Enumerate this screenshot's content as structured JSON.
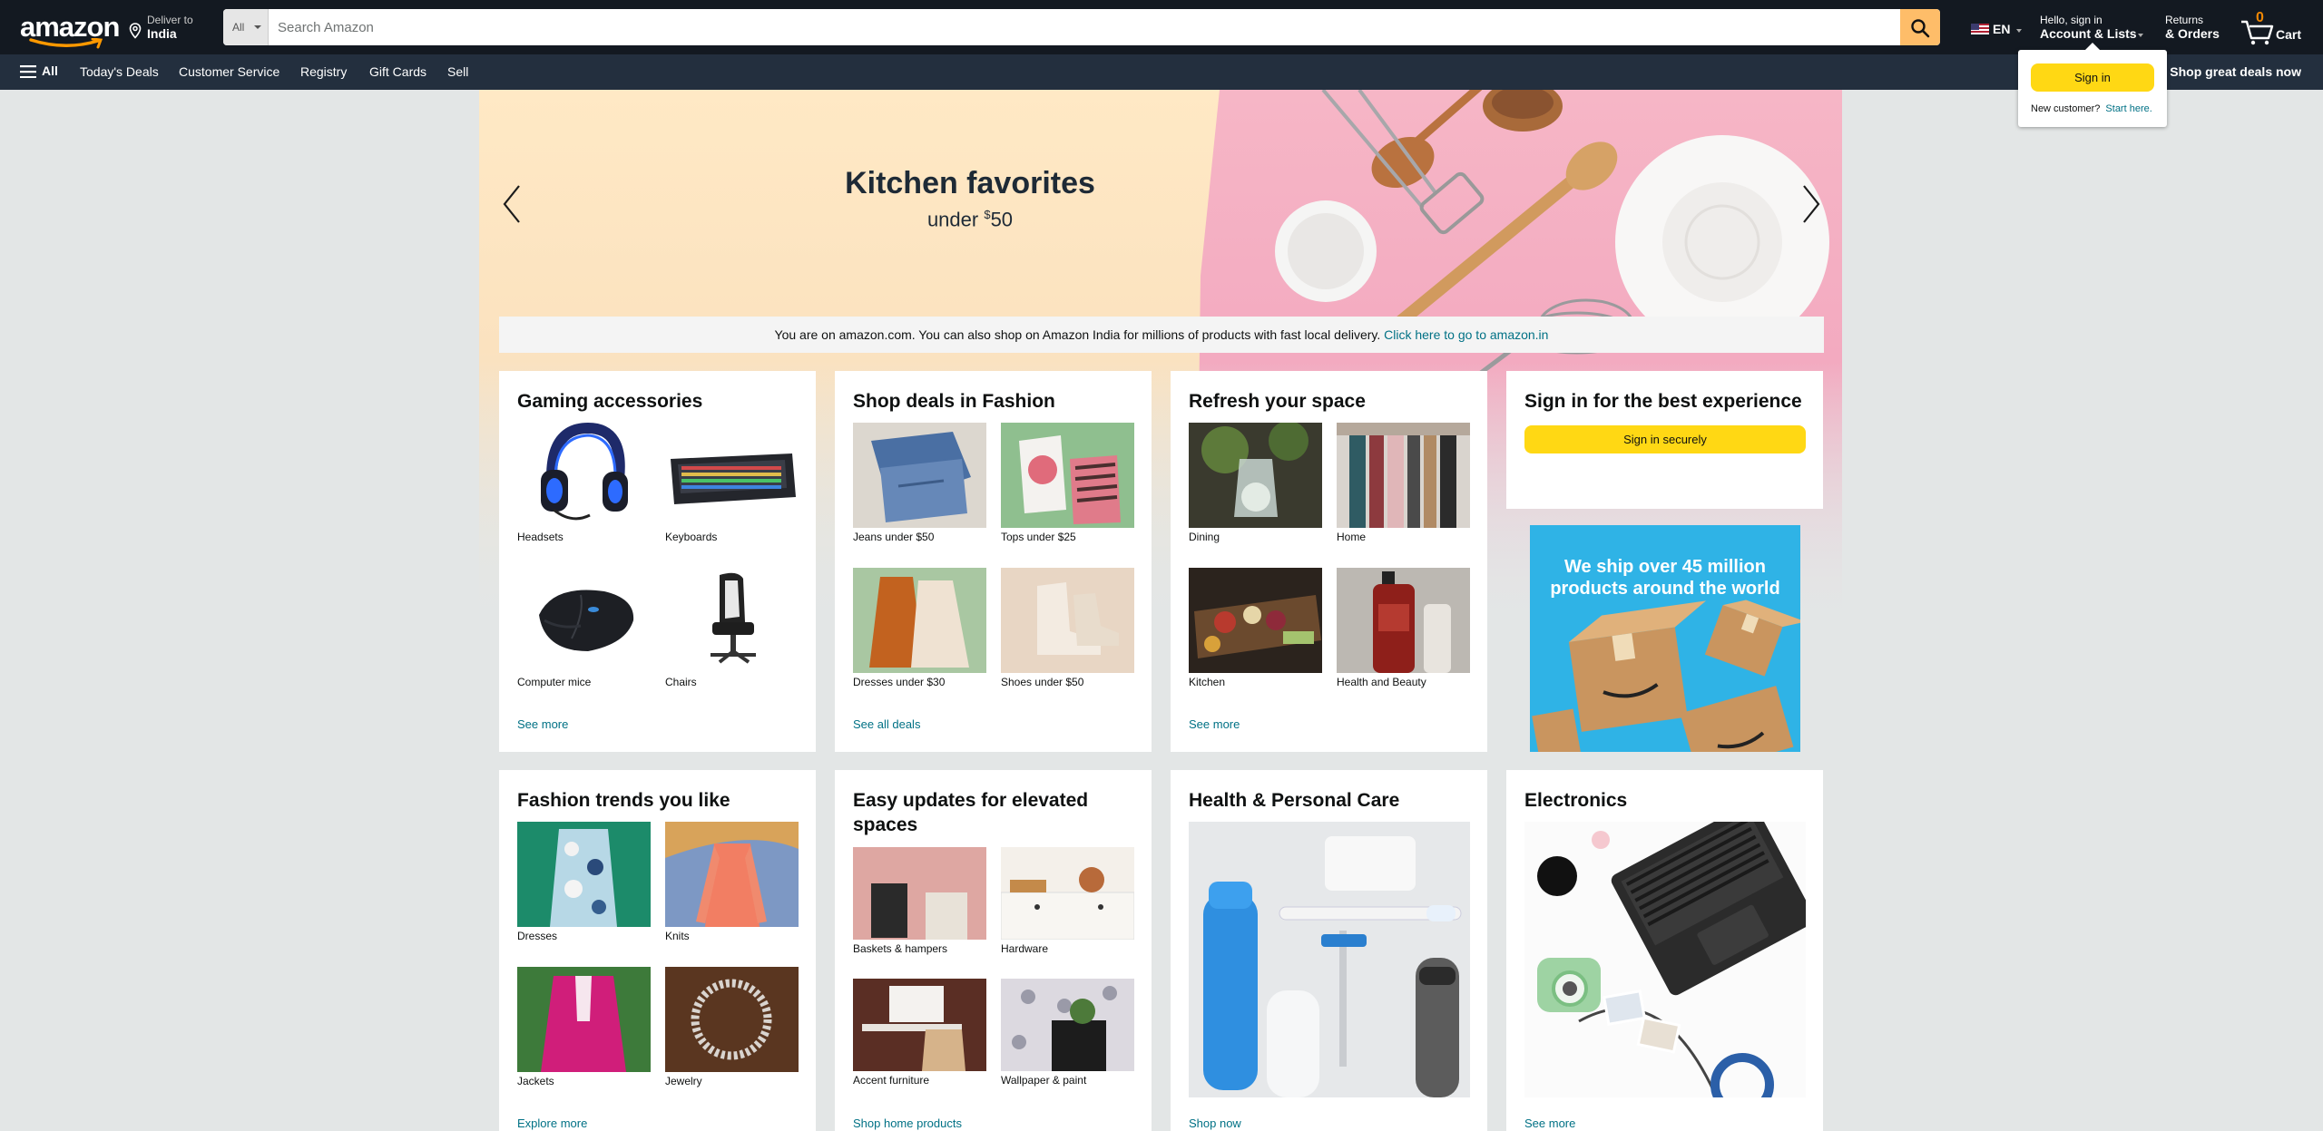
{
  "header": {
    "logo_text": "amazon",
    "deliver_line1": "Deliver to",
    "deliver_line2": "India",
    "search_category": "All",
    "search_placeholder": "Search Amazon",
    "lang": "EN",
    "account_line1": "Hello, sign in",
    "account_line2": "Account & Lists",
    "returns_line1": "Returns",
    "returns_line2": "& Orders",
    "cart_count": "0",
    "cart_label": "Cart"
  },
  "subnav": {
    "all_label": "All",
    "links": [
      "Today's Deals",
      "Customer Service",
      "Registry",
      "Gift Cards",
      "Sell"
    ],
    "promo": "Shop great deals now"
  },
  "flyout": {
    "signin_label": "Sign in",
    "new_customer": "New customer?",
    "start_here": "Start here."
  },
  "hero": {
    "title": "Kitchen favorites",
    "sub_prefix": "under ",
    "sub_currency": "$",
    "sub_amount": "50"
  },
  "notice": {
    "text": "You are on amazon.com. You can also shop on Amazon India for millions of products with fast local delivery. ",
    "link": "Click here to go to amazon.in"
  },
  "cards": {
    "gaming": {
      "title": "Gaming accessories",
      "tiles": [
        "Headsets",
        "Keyboards",
        "Computer mice",
        "Chairs"
      ],
      "more": "See more"
    },
    "fashion": {
      "title": "Shop deals in Fashion",
      "tiles": [
        "Jeans under $50",
        "Tops under $25",
        "Dresses under $30",
        "Shoes under $50"
      ],
      "more": "See all deals"
    },
    "refresh": {
      "title": "Refresh your space",
      "tiles": [
        "Dining",
        "Home",
        "Kitchen",
        "Health and Beauty"
      ],
      "more": "See more"
    },
    "signin": {
      "title": "Sign in for the best experience",
      "button": "Sign in securely"
    },
    "ship_ad": {
      "text": "We ship over 45 million products around the world"
    },
    "trends": {
      "title": "Fashion trends you like",
      "tiles": [
        "Dresses",
        "Knits",
        "Jackets",
        "Jewelry"
      ],
      "more": "Explore more"
    },
    "updates": {
      "title": "Easy updates for elevated spaces",
      "tiles": [
        "Baskets & hampers",
        "Hardware",
        "Accent furniture",
        "Wallpaper & paint"
      ],
      "more": "Shop home products"
    },
    "health": {
      "title": "Health & Personal Care",
      "more": "Shop now"
    },
    "electronics": {
      "title": "Electronics",
      "more": "See more"
    }
  },
  "colors": {
    "nav_dark": "#131921",
    "nav_sub": "#232f3e",
    "search_button": "#febd69",
    "cta_yellow": "#ffd814",
    "link": "#007185",
    "cart_count": "#f08804",
    "page_bg": "#e3e6e6"
  }
}
